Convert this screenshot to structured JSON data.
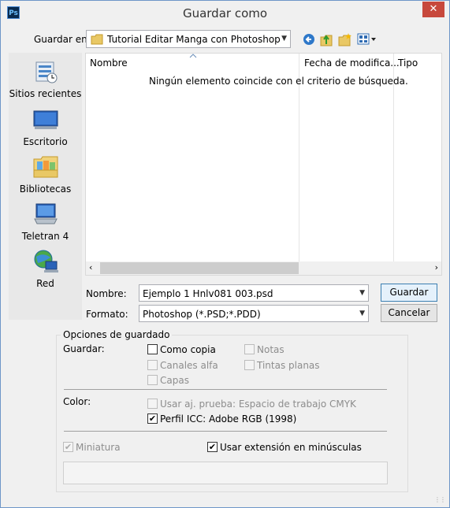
{
  "window": {
    "title": "Guardar como",
    "app_icon": "Ps",
    "close_glyph": "✕"
  },
  "toolbar": {
    "save_in_label": "Guardar en:",
    "location": "Tutorial Editar Manga con Photoshop"
  },
  "places": [
    {
      "label": "Sitios recientes",
      "icon": "recent-places-icon"
    },
    {
      "label": "Escritorio",
      "icon": "desktop-icon"
    },
    {
      "label": "Bibliotecas",
      "icon": "libraries-icon"
    },
    {
      "label": "Teletran 4",
      "icon": "computer-icon"
    },
    {
      "label": "Red",
      "icon": "network-icon"
    }
  ],
  "filelist": {
    "columns": [
      "Nombre",
      "Fecha de modifica...",
      "Tipo"
    ],
    "empty_message": "Ningún elemento coincide con el criterio de búsqueda."
  },
  "form": {
    "name_label": "Nombre:",
    "name_value": "Ejemplo 1 Hnlv081 003.psd",
    "format_label": "Formato:",
    "format_value": "Photoshop (*.PSD;*.PDD)",
    "save_button": "Guardar",
    "cancel_button": "Cancelar"
  },
  "options": {
    "group_title": "Opciones de guardado",
    "save_label": "Guardar:",
    "as_copy": "Como copia",
    "notes": "Notas",
    "alpha_channels": "Canales alfa",
    "spot_colors": "Tintas planas",
    "layers": "Capas",
    "color_label": "Color:",
    "proof_setup": "Usar aj. prueba: Espacio de trabajo CMYK",
    "icc_profile": "Perfil ICC: Adobe RGB (1998)",
    "thumbnail": "Miniatura",
    "lowercase_ext": "Usar extensión en minúsculas"
  },
  "check_glyph": "✔",
  "colors": {
    "accent": "#3c7fb1",
    "close": "#c7483c"
  }
}
